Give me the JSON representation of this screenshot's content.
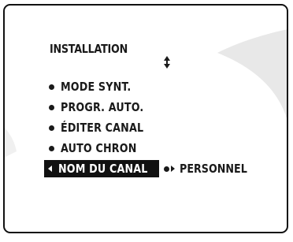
{
  "menu": {
    "title": "INSTALLATION",
    "items": [
      {
        "label": "MODE SYNT."
      },
      {
        "label": "PROGR. AUTO."
      },
      {
        "label": "ÉDITER CANAL"
      },
      {
        "label": "AUTO CHRON"
      }
    ],
    "selected": {
      "label": "NOM DU CANAL",
      "value": "PERSONNEL"
    }
  },
  "icons": {
    "scroll": "up-down-arrow-icon",
    "left": "left-triangle-icon",
    "value_bullet": "dot-icon",
    "value_arrow": "right-triangle-icon"
  },
  "colors": {
    "text": "#1a1a1a",
    "highlight_bg": "#111111",
    "highlight_text": "#ffffff",
    "glare": "#e8e8e8"
  }
}
